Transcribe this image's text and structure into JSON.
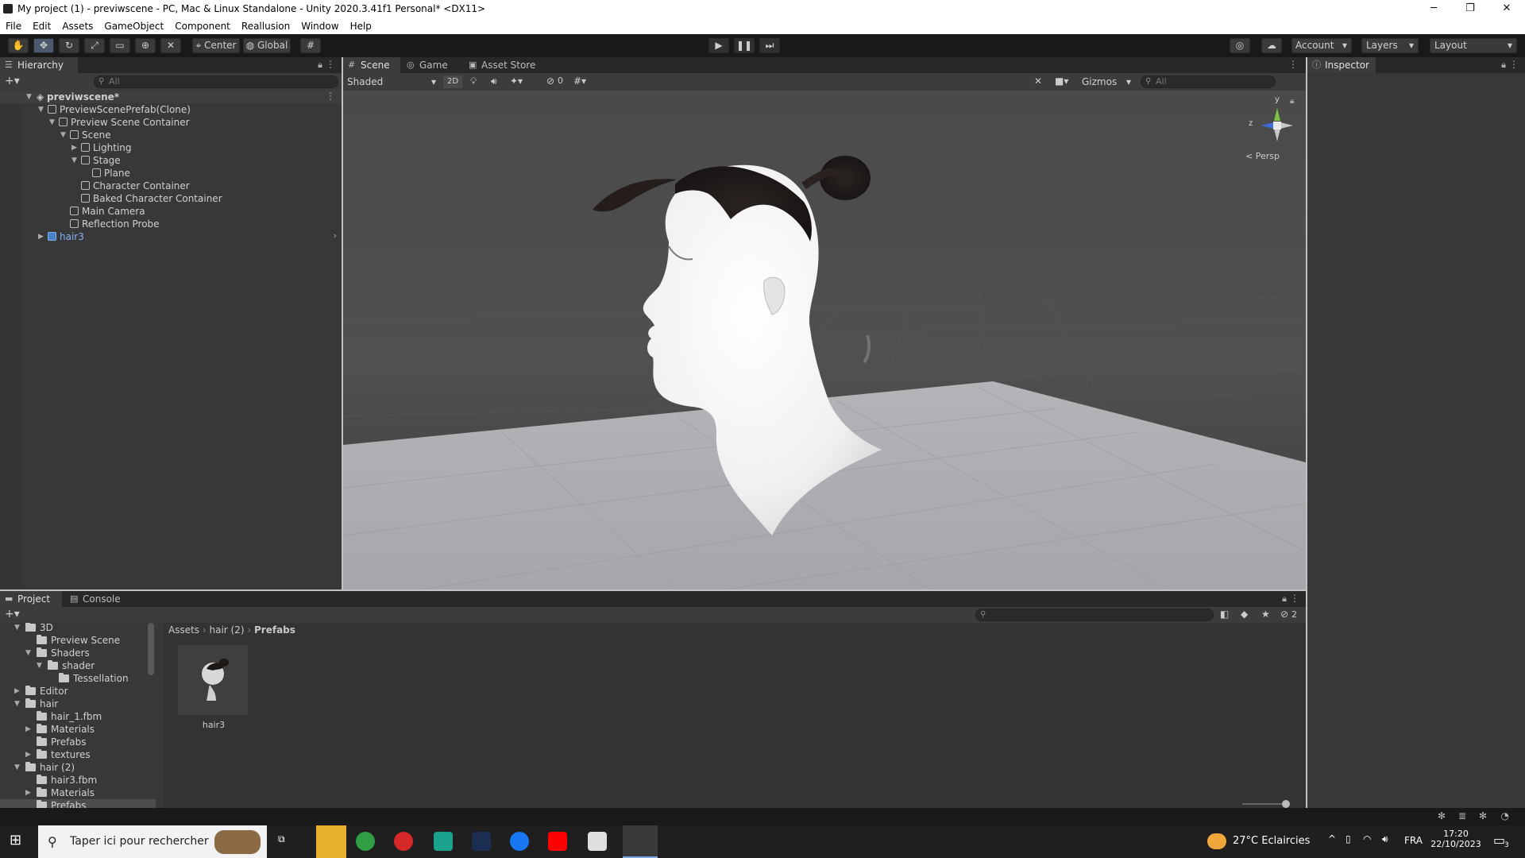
{
  "window": {
    "title": "My project (1) - previwscene - PC, Mac & Linux Standalone - Unity 2020.3.41f1 Personal* <DX11>",
    "controls": [
      "─",
      "❐",
      "✕"
    ]
  },
  "menu": [
    "File",
    "Edit",
    "Assets",
    "GameObject",
    "Component",
    "Reallusion",
    "Window",
    "Help"
  ],
  "toolbar": {
    "pivot": "Center",
    "space": "Global",
    "account": "Account",
    "layers": "Layers",
    "layout": "Layout"
  },
  "hierarchy": {
    "tab": "Hierarchy",
    "search_placeholder": "All",
    "items": [
      {
        "label": "previwscene*",
        "depth": 0,
        "type": "scene"
      },
      {
        "label": "PreviewScenePrefab(Clone)",
        "depth": 1
      },
      {
        "label": "Preview Scene Container",
        "depth": 2
      },
      {
        "label": "Scene",
        "depth": 3
      },
      {
        "label": "Lighting",
        "depth": 4
      },
      {
        "label": "Stage",
        "depth": 4
      },
      {
        "label": "Plane",
        "depth": 5
      },
      {
        "label": "Character Container",
        "depth": 4
      },
      {
        "label": "Baked Character Container",
        "depth": 4
      },
      {
        "label": "Main Camera",
        "depth": 3
      },
      {
        "label": "Reflection Probe",
        "depth": 3
      },
      {
        "label": "hair3",
        "depth": 1,
        "type": "prefab"
      }
    ]
  },
  "scene": {
    "tabs": [
      "Scene",
      "Game",
      "Asset Store"
    ],
    "draw_mode": "Shaded",
    "mode_2d": "2D",
    "hidden_count": "0",
    "gizmos": "Gizmos",
    "search_placeholder": "All",
    "projection": "Persp",
    "axis_y": "y",
    "axis_z": "z"
  },
  "inspector": {
    "tab": "Inspector"
  },
  "project": {
    "tabs": [
      "Project",
      "Console"
    ],
    "breadcrumb": [
      "Assets",
      "hair (2)",
      "Prefabs"
    ],
    "hidden_count": "2",
    "tree": [
      {
        "label": "3D",
        "depth": 0
      },
      {
        "label": "Preview Scene",
        "depth": 1
      },
      {
        "label": "Shaders",
        "depth": 1
      },
      {
        "label": "shader",
        "depth": 2
      },
      {
        "label": "Tessellation",
        "depth": 3
      },
      {
        "label": "Editor",
        "depth": 0
      },
      {
        "label": "hair",
        "depth": 0
      },
      {
        "label": "hair_1.fbm",
        "depth": 1
      },
      {
        "label": "Materials",
        "depth": 1
      },
      {
        "label": "Prefabs",
        "depth": 1
      },
      {
        "label": "textures",
        "depth": 1
      },
      {
        "label": "hair (2)",
        "depth": 0
      },
      {
        "label": "hair3.fbm",
        "depth": 1
      },
      {
        "label": "Materials",
        "depth": 1
      },
      {
        "label": "Prefabs",
        "depth": 1
      }
    ],
    "assets": [
      {
        "label": "hair3"
      }
    ]
  },
  "taskbar": {
    "search_placeholder": "Taper ici pour rechercher",
    "weather": "27°C  Eclaircies",
    "language": "FRA",
    "time": "17:20",
    "date": "22/10/2023",
    "notifications": "3"
  },
  "colors": {
    "accent": "#4c7fc4",
    "prefab": "#7fb3f5",
    "panel": "#383838",
    "toolbar": "#191919"
  }
}
